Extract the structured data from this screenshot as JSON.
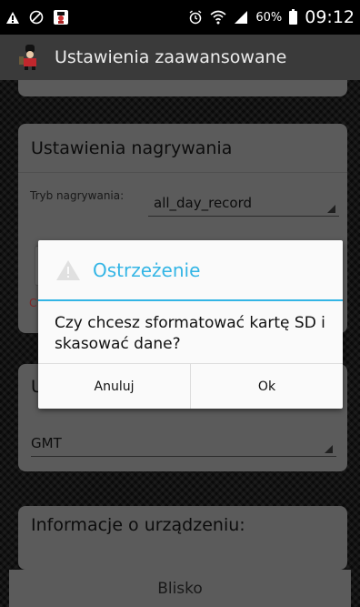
{
  "status_bar": {
    "battery_percent": "60%",
    "time": "09:12",
    "icons": [
      "warning-icon",
      "blocked-icon",
      "app-notification-icon",
      "alarm-icon",
      "wifi-icon",
      "signal-icon",
      "battery-icon"
    ]
  },
  "app_bar": {
    "title": "Ustawienia zaawansowane",
    "icon": "app-logo-icon"
  },
  "recording": {
    "title": "Ustawienia nagrywania",
    "mode_label": "Tryb nagrywania:",
    "mode_value": "all_day_record",
    "partial_text": "C d"
  },
  "timezone": {
    "partial_title": "U",
    "value": "GMT"
  },
  "device_info": {
    "title": "Informacje o urządzeniu:"
  },
  "bottom_button": {
    "label": "Blisko"
  },
  "dialog": {
    "title": "Ostrzeżenie",
    "icon": "warning-icon",
    "message": "Czy chcesz sformatować kartę SD i skasować dane?",
    "cancel_label": "Anuluj",
    "ok_label": "Ok",
    "accent_color": "#33b5e5"
  }
}
